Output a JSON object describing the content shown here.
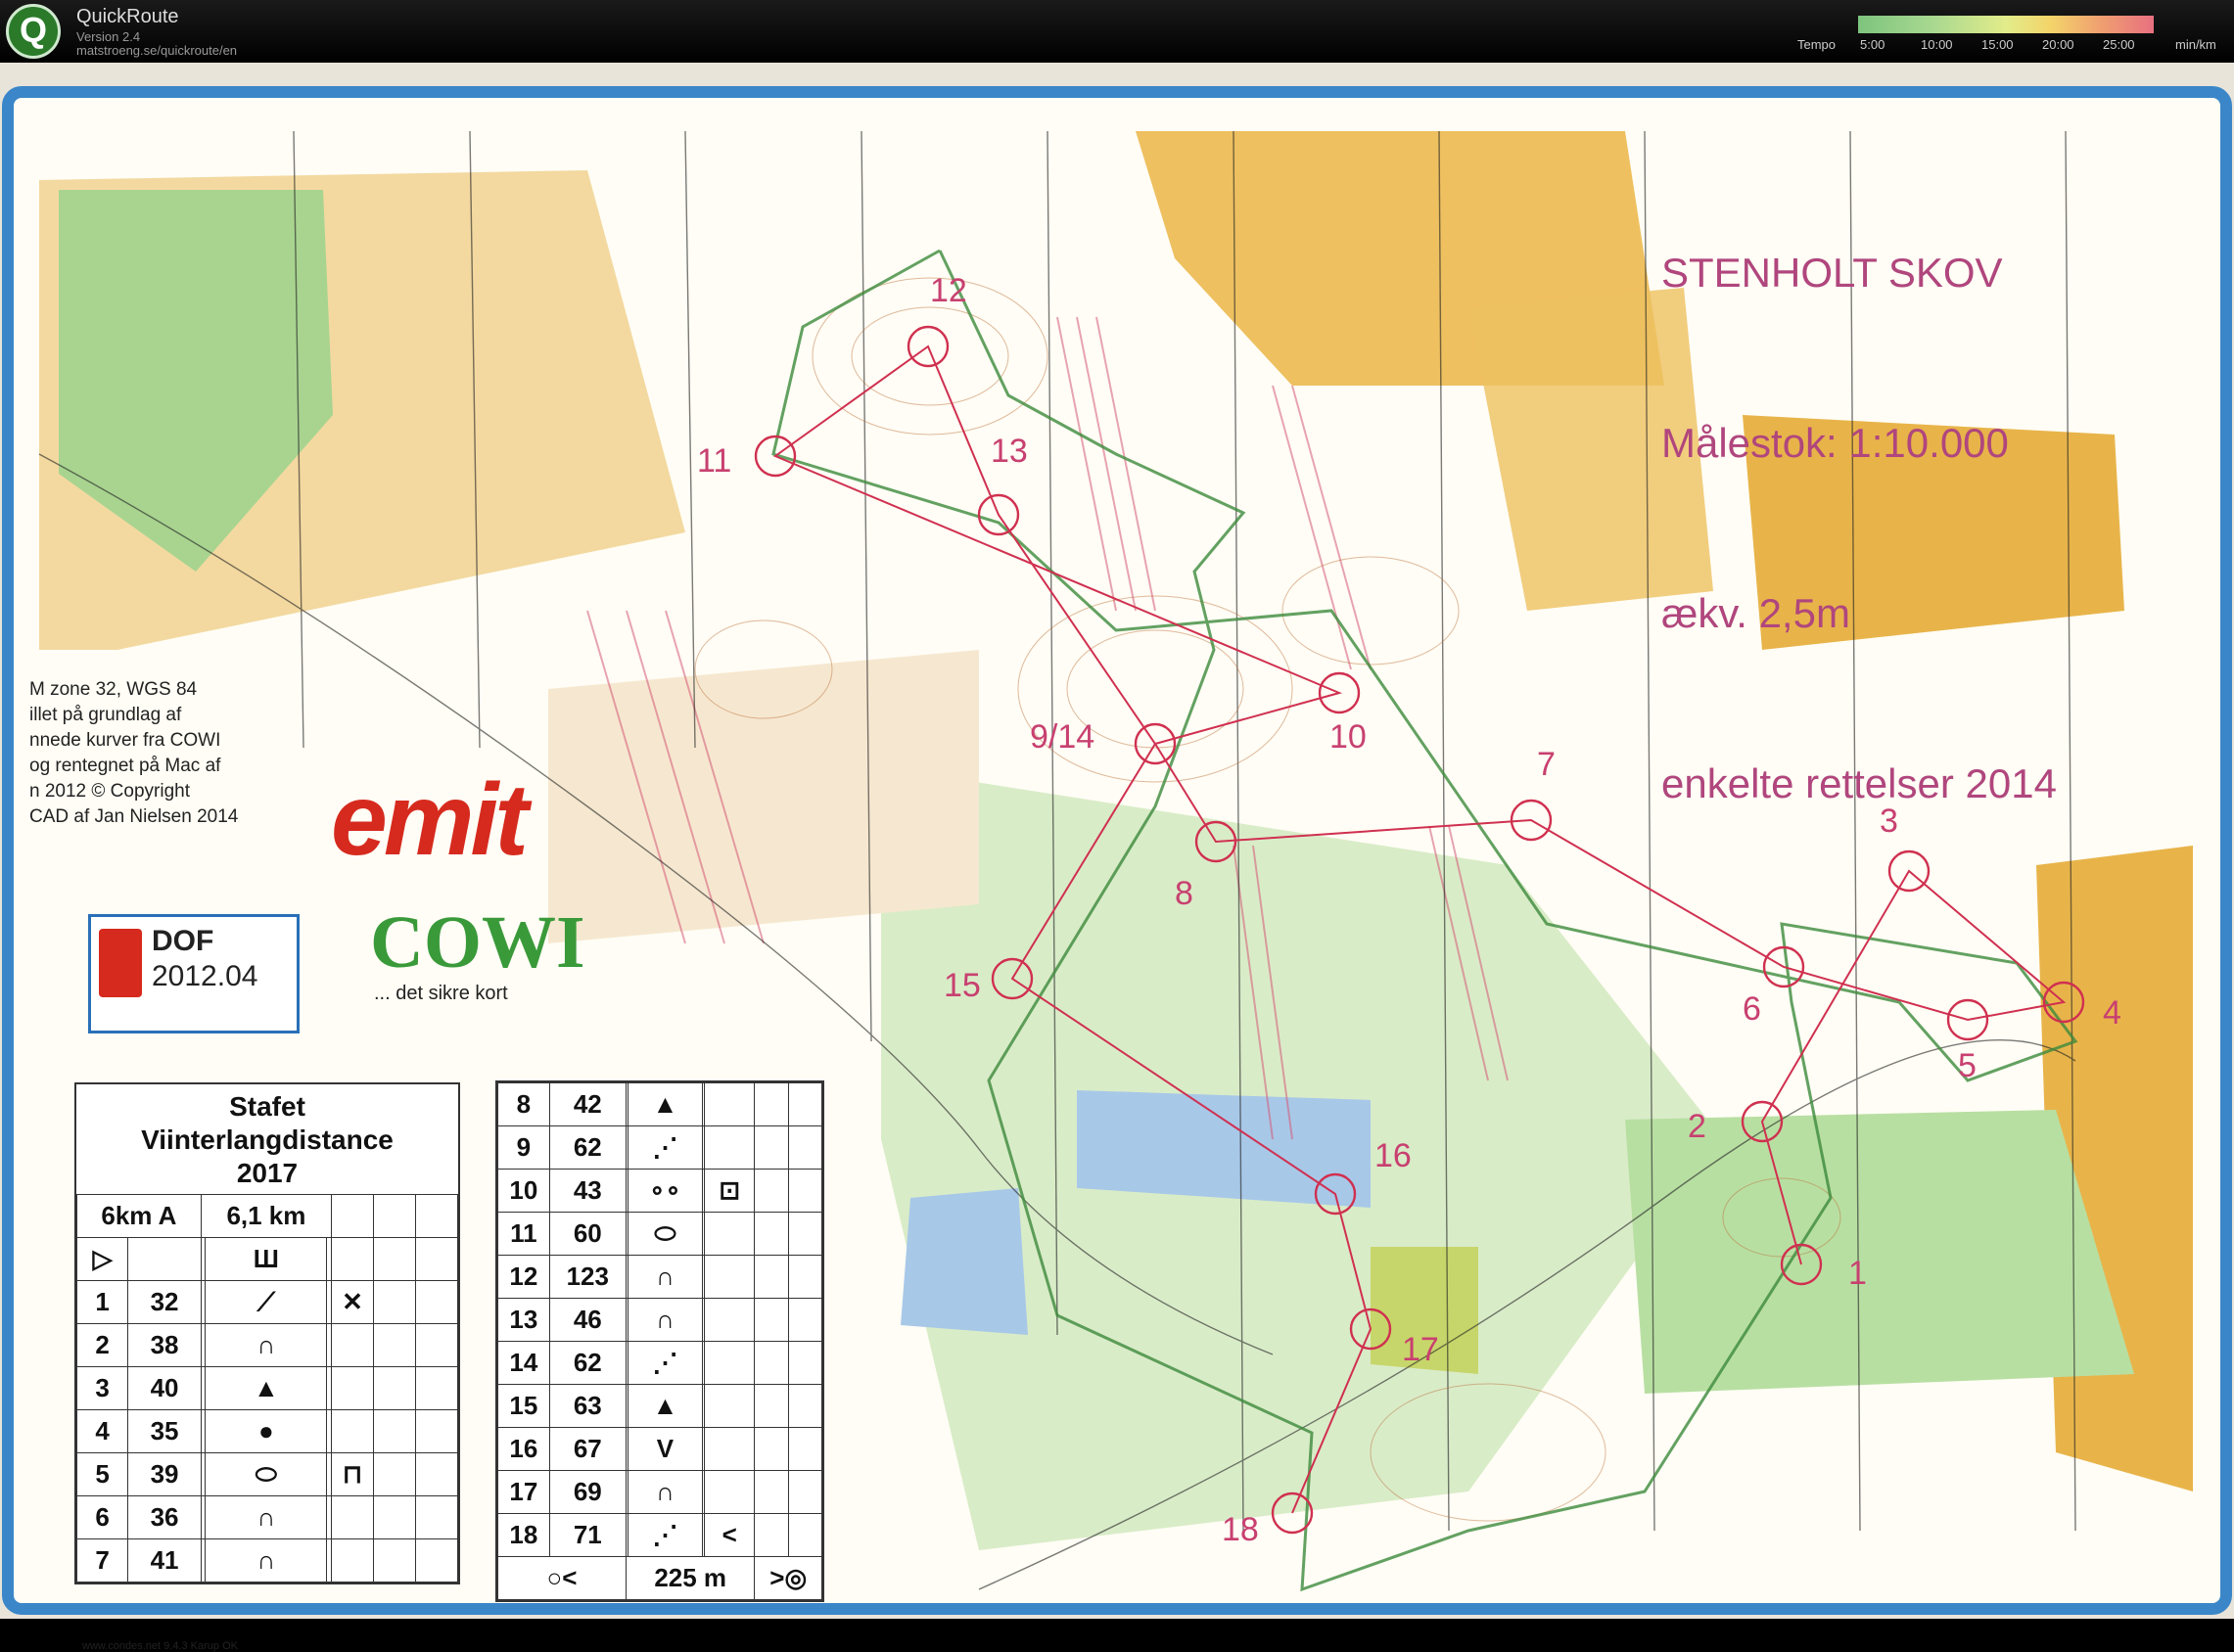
{
  "app": {
    "name": "QuickRoute",
    "version": "Version 2.4",
    "url": "matstroeng.se/quickroute/en",
    "logo_glyph": "Q"
  },
  "tempo": {
    "label": "Tempo",
    "ticks": [
      "5:00",
      "10:00",
      "15:00",
      "20:00",
      "25:00"
    ],
    "unit": "min/km",
    "colors": [
      "#7ec47e",
      "#e2ec8a",
      "#f3d46a",
      "#e87080"
    ]
  },
  "map": {
    "title_lines": [
      "STENHOLT SKOV",
      "Målestok: 1:10.000",
      "ækv. 2,5m",
      "enkelte rettelser 2014"
    ],
    "credits_lines": [
      "M zone 32, WGS 84",
      "",
      "illet på grundlag af",
      "nnede kurver fra COWI",
      "og rentegnet på Mac af",
      "n 2012    © Copyright",
      "CAD af Jan Nielsen 2014"
    ],
    "emit_text": "emit",
    "cowi_text": "COWI",
    "cowi_tagline": "... det sikre kort",
    "dof_name": "DOF",
    "dof_version": "2012.04",
    "footer": "www.condes.net 9.4.3 Karup OK",
    "control_labels": [
      "1",
      "2",
      "3",
      "4",
      "5",
      "6",
      "7",
      "8",
      "9/14",
      "10",
      "11",
      "12",
      "13",
      "15",
      "16",
      "17",
      "18"
    ]
  },
  "legend": {
    "title": "Stafet\nViinterlangdistance\n2017",
    "course": "6km A",
    "length": "6,1 km",
    "start_symbol": "▷",
    "start_feature": "Ш",
    "rows_left": [
      {
        "n": "1",
        "code": "32",
        "feat": "⟋",
        "extra": "✕"
      },
      {
        "n": "2",
        "code": "38",
        "feat": "∩",
        "extra": ""
      },
      {
        "n": "3",
        "code": "40",
        "feat": "▲",
        "extra": ""
      },
      {
        "n": "4",
        "code": "35",
        "feat": "●",
        "extra": ""
      },
      {
        "n": "5",
        "code": "39",
        "feat": "⬭",
        "extra": "⊓"
      },
      {
        "n": "6",
        "code": "36",
        "feat": "∩",
        "extra": ""
      },
      {
        "n": "7",
        "code": "41",
        "feat": "∩",
        "extra": ""
      }
    ],
    "rows_right": [
      {
        "n": "8",
        "code": "42",
        "feat": "▲",
        "extra": ""
      },
      {
        "n": "9",
        "code": "62",
        "feat": "⋰",
        "extra": ""
      },
      {
        "n": "10",
        "code": "43",
        "feat": "∘∘",
        "extra": "⊡"
      },
      {
        "n": "11",
        "code": "60",
        "feat": "⬭",
        "extra": ""
      },
      {
        "n": "12",
        "code": "123",
        "feat": "∩",
        "extra": ""
      },
      {
        "n": "13",
        "code": "46",
        "feat": "∩",
        "extra": ""
      },
      {
        "n": "14",
        "code": "62",
        "feat": "⋰",
        "extra": ""
      },
      {
        "n": "15",
        "code": "63",
        "feat": "▲",
        "extra": ""
      },
      {
        "n": "16",
        "code": "67",
        "feat": "V",
        "extra": ""
      },
      {
        "n": "17",
        "code": "69",
        "feat": "∩",
        "extra": ""
      },
      {
        "n": "18",
        "code": "71",
        "feat": "⋰",
        "extra": "<"
      }
    ],
    "finish_left": "○<",
    "finish_distance": "225 m",
    "finish_right": ">◎"
  }
}
